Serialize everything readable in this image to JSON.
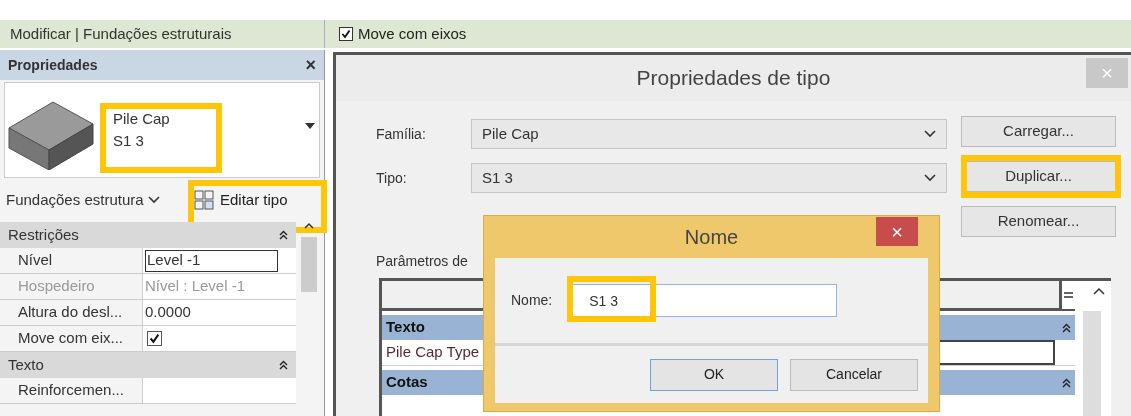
{
  "ribbon_context": "Modificar | Fundações estruturais",
  "options_bar": {
    "label": "Move com eixos",
    "checked": true
  },
  "properties": {
    "title": "Propriedades",
    "close": "×",
    "type_name": {
      "lines": [
        "Pile Cap",
        "S1 3"
      ],
      "highlighted": true
    },
    "category_dropdown": "Fundações estrutura",
    "edit_type_button": {
      "label": "Editar tipo",
      "highlighted": true
    },
    "groups": [
      {
        "title": "Restrições",
        "rows": [
          {
            "label": "Nível",
            "value": "Level -1",
            "kind": "field",
            "disabled": false
          },
          {
            "label": "Hospedeiro",
            "value": "Nível : Level -1",
            "kind": "text",
            "disabled": true
          },
          {
            "label": "Altura do desl...",
            "value": "0.0000",
            "kind": "text",
            "disabled": false
          },
          {
            "label": "Move com eix...",
            "checked": true,
            "kind": "checkbox",
            "disabled": false
          }
        ]
      },
      {
        "title": "Texto",
        "rows": [
          {
            "label": "Reinforcemen...",
            "kind": "text",
            "disabled": false
          }
        ]
      }
    ]
  },
  "type_dialog": {
    "title": "Propriedades de tipo",
    "close": "×",
    "fields": [
      {
        "label": "Família:",
        "value": "Pile Cap"
      },
      {
        "label": "Tipo:",
        "value": "S1 3"
      }
    ],
    "buttons": [
      {
        "label": "Carregar...",
        "highlighted": false
      },
      {
        "label": "Duplicar...",
        "highlighted": true
      },
      {
        "label": "Renomear...",
        "highlighted": false
      }
    ],
    "parameters_label": "Parâmetros de",
    "grid_groups": [
      {
        "title": "Texto",
        "rows": [
          "Pile Cap Type"
        ]
      },
      {
        "title": "Cotas"
      }
    ]
  },
  "name_dialog": {
    "title": "Nome",
    "close": "×",
    "field_label": "Nome:",
    "value": "S1 3",
    "value_highlighted": true,
    "buttons": [
      {
        "label": "OK",
        "default": true
      },
      {
        "label": "Cancelar",
        "default": false
      }
    ]
  }
}
